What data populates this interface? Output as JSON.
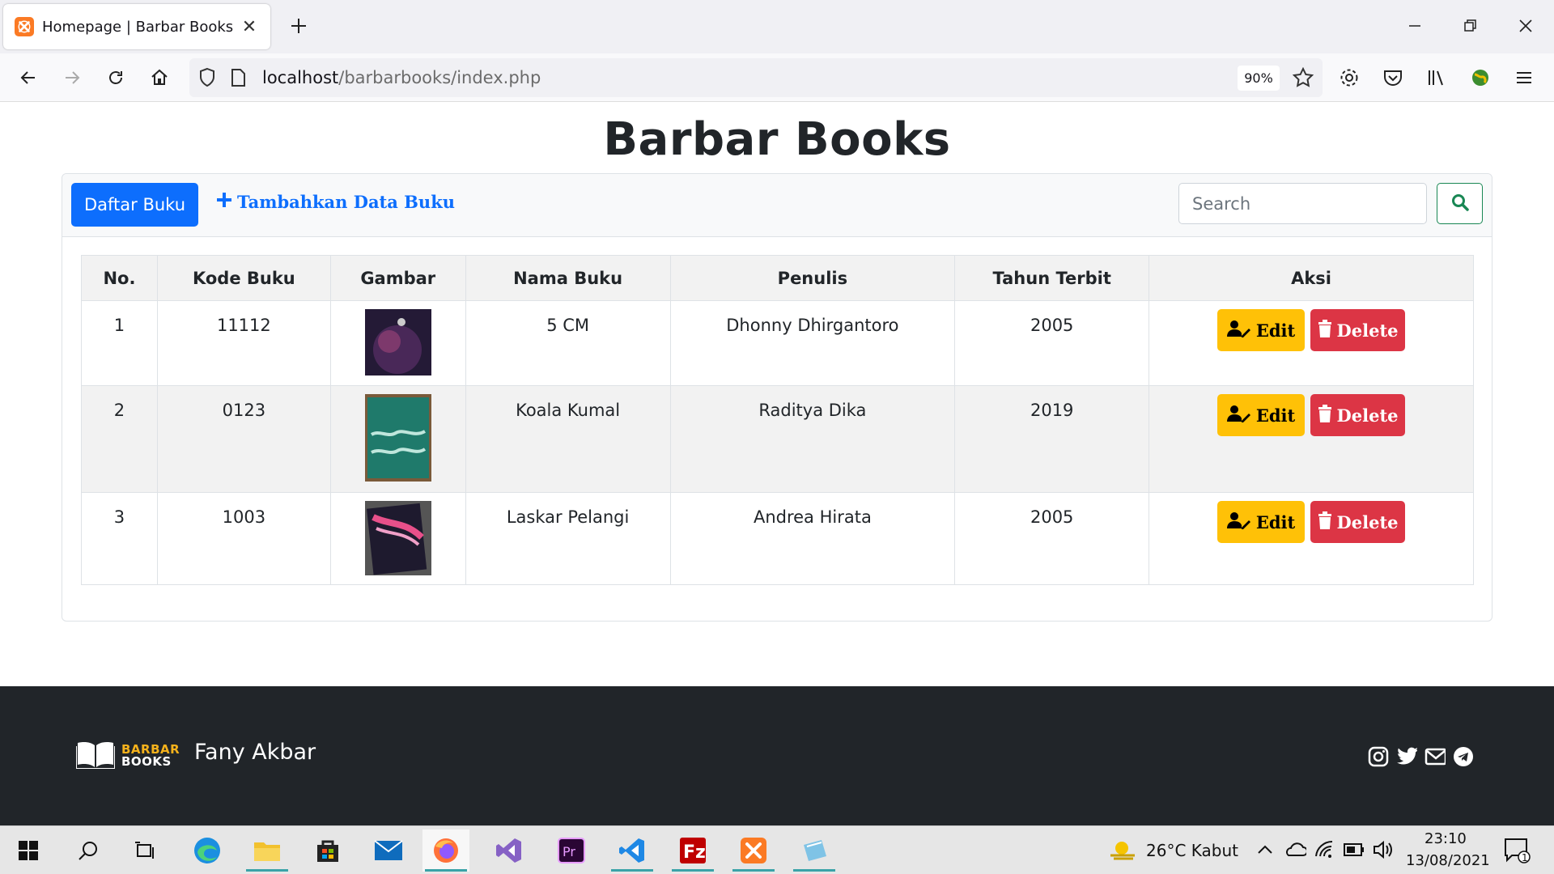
{
  "browser": {
    "tab_title": "Homepage | Barbar Books",
    "url_host": "localhost",
    "url_path": "/barbarbooks/index.php",
    "zoom": "90%"
  },
  "page": {
    "title": "Barbar Books",
    "daftar_button": "Daftar Buku",
    "tambah_link": "Tambahkan Data Buku",
    "search_placeholder": "Search"
  },
  "table": {
    "headers": [
      "No.",
      "Kode Buku",
      "Gambar",
      "Nama Buku",
      "Penulis",
      "Tahun Terbit",
      "Aksi"
    ],
    "rows": [
      {
        "no": "1",
        "kode": "11112",
        "nama": "5 CM",
        "penulis": "Dhonny Dhirgantoro",
        "tahun": "2005",
        "cover_color": "#2a1f3d"
      },
      {
        "no": "2",
        "kode": "0123",
        "nama": "Koala Kumal",
        "penulis": "Raditya Dika",
        "tahun": "2019",
        "cover_color": "#1f6f62"
      },
      {
        "no": "3",
        "kode": "1003",
        "nama": "Laskar Pelangi",
        "penulis": "Andrea Hirata",
        "tahun": "2005",
        "cover_color": "#3a2a4a"
      }
    ],
    "edit_label": "Edit",
    "delete_label": "Delete"
  },
  "footer": {
    "logo_line1": "BARBAR",
    "logo_line2": "BOOKS",
    "author": "Fany Akbar",
    "socials": [
      "instagram-icon",
      "twitter-icon",
      "mail-icon",
      "telegram-icon"
    ]
  },
  "taskbar": {
    "weather": "26°C  Kabut",
    "time": "23:10",
    "date": "13/08/2021",
    "notification_count": "1"
  },
  "colors": {
    "primary": "#0d6efd",
    "warning": "#ffc107",
    "danger": "#dc3545",
    "success": "#198754",
    "footer_bg": "#212529"
  }
}
